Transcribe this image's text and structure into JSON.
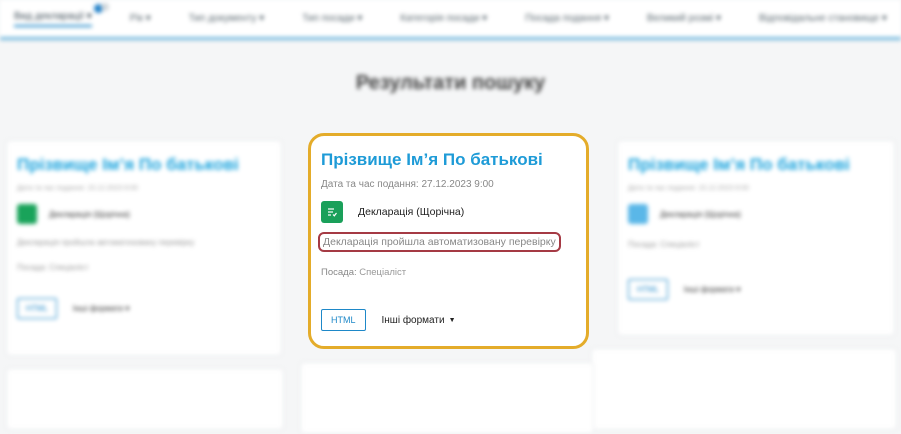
{
  "filters": [
    {
      "label": "Вид декларації ▾"
    },
    {
      "label": "Рік ▾"
    },
    {
      "label": "Тип документу ▾"
    },
    {
      "label": "Тип посади ▾"
    },
    {
      "label": "Категорія посади ▾"
    },
    {
      "label": "Посада подання ▾"
    },
    {
      "label": "Великий розмі ▾"
    },
    {
      "label": "Відповідальне становище ▾"
    }
  ],
  "page": {
    "title": "Результати пошуку"
  },
  "card": {
    "name": "Прізвище Ім’я По батькові",
    "date_label": "Дата та час подання:",
    "date_value": "27.12.2023 9:00",
    "type": "Декларація (Щорічна)",
    "check_status": "Декларація пройшла автоматизовану перевірку",
    "position_label": "Посада:",
    "position_value": "Спеціаліст",
    "html_button": "HTML",
    "other_formats": "Інші формати"
  },
  "bg_left": {
    "name": "Прізвище Ім’я По батькові",
    "date": "Дата та час подання: 15.12.2023 9:00",
    "type": "Декларація (Щорічна)",
    "check": "Декларація пройшла автоматизовану перевірку",
    "position": "Посада: Спеціаліст",
    "html_button": "HTML",
    "other_formats": "Інші формати ▾"
  },
  "bg_right": {
    "name": "Прізвище Ім’я По батькові",
    "date": "Дата та час подання: 15.12.2023 9:00",
    "type": "Декларація (Щорічна)",
    "position": "Посада: Спеціаліст",
    "html_button": "HTML",
    "other_formats": "Інші формати ▾"
  },
  "colors": {
    "accent_blue": "#1e9bd7",
    "focus_border": "#e4ac2a",
    "check_border": "#a53a44",
    "icon_green": "#1aa05a",
    "filter_underline": "#6fb6dc"
  },
  "icons": {
    "type_icon": "document-list-icon",
    "caret": "caret-down-icon"
  }
}
